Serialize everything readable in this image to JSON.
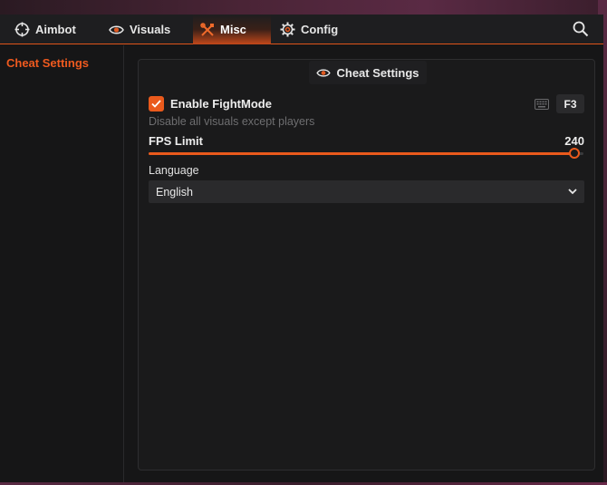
{
  "colors": {
    "accent": "#ea5a1c",
    "background": "#161617",
    "panel": "#1a1a1b",
    "muted_text": "#6e6e70"
  },
  "tabs": [
    {
      "label": "Aimbot",
      "icon": "crosshair-icon",
      "active": false
    },
    {
      "label": "Visuals",
      "icon": "eye-icon",
      "active": false
    },
    {
      "label": "Misc",
      "icon": "tools-icon",
      "active": true
    },
    {
      "label": "Config",
      "icon": "gear-icon",
      "active": false
    }
  ],
  "header": {
    "search_icon": "search-icon"
  },
  "sidebar": {
    "items": [
      {
        "label": "Cheat Settings",
        "active": true
      }
    ]
  },
  "panel": {
    "title": "Cheat Settings",
    "title_icon": "eye-icon",
    "fightmode": {
      "label": "Enable FightMode",
      "checked": true,
      "keybind": "F3",
      "keybind_icon": "keyboard-icon",
      "description": "Disable all visuals except players"
    },
    "fps_limit": {
      "label": "FPS Limit",
      "value": "240",
      "fraction": 0.98
    },
    "language": {
      "label": "Language",
      "selected": "English"
    }
  }
}
